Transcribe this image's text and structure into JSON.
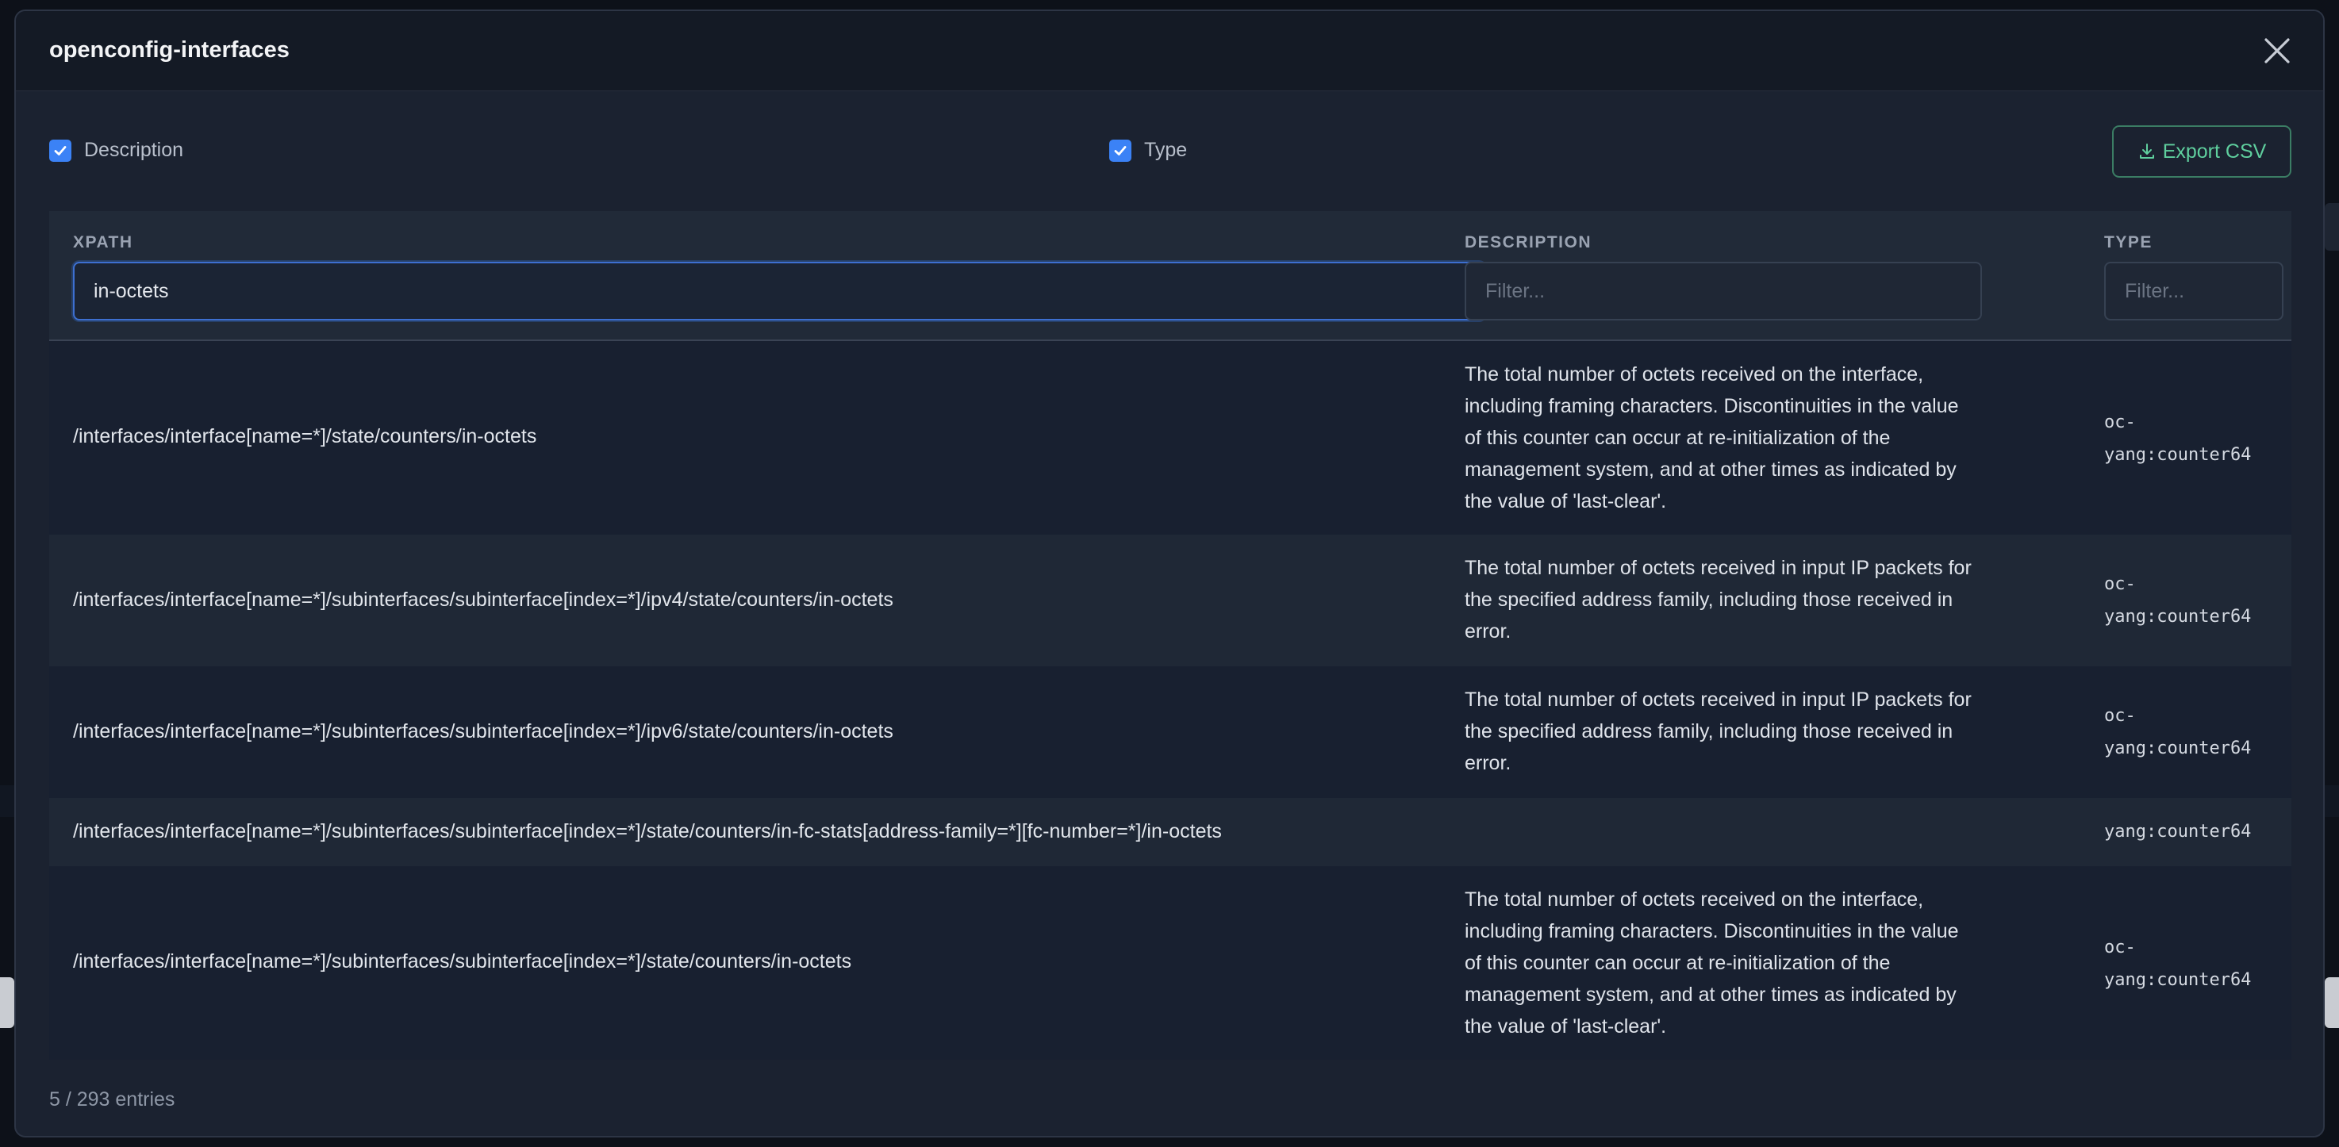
{
  "modal": {
    "title": "openconfig-interfaces",
    "close_icon": "close-icon"
  },
  "toolbar": {
    "description_toggle": {
      "label": "Description",
      "checked": true
    },
    "type_toggle": {
      "label": "Type",
      "checked": true
    },
    "export_label": "Export CSV",
    "export_icon": "download-icon"
  },
  "table": {
    "columns": {
      "xpath": "XPATH",
      "description": "DESCRIPTION",
      "type": "TYPE"
    },
    "filters": {
      "xpath_value": "in-octets",
      "description_placeholder": "Filter...",
      "type_placeholder": "Filter..."
    },
    "rows": [
      {
        "xpath": "/interfaces/interface[name=*]/state/counters/in-octets",
        "description": "The total number of octets received on the interface, including framing characters. Discontinuities in the value of this counter can occur at re-initialization of the management system, and at other times as indicated by the value of 'last-clear'.",
        "type": "oc-yang:counter64"
      },
      {
        "xpath": "/interfaces/interface[name=*]/subinterfaces/subinterface[index=*]/ipv4/state/counters/in-octets",
        "description": "The total number of octets received in input IP packets for the specified address family, including those received in error.",
        "type": "oc-yang:counter64"
      },
      {
        "xpath": "/interfaces/interface[name=*]/subinterfaces/subinterface[index=*]/ipv6/state/counters/in-octets",
        "description": "The total number of octets received in input IP packets for the specified address family, including those received in error.",
        "type": "oc-yang:counter64"
      },
      {
        "xpath": "/interfaces/interface[name=*]/subinterfaces/subinterface[index=*]/state/counters/in-fc-stats[address-family=*][fc-number=*]/in-octets",
        "description": "",
        "type": "yang:counter64"
      },
      {
        "xpath": "/interfaces/interface[name=*]/subinterfaces/subinterface[index=*]/state/counters/in-octets",
        "description": "The total number of octets received on the interface, including framing characters. Discontinuities in the value of this counter can occur at re-initialization of the management system, and at other times as indicated by the value of 'last-clear'.",
        "type": "oc-yang:counter64"
      }
    ]
  },
  "footer": {
    "entries": "5 / 293 entries"
  },
  "colors": {
    "accent": "#3b82f6",
    "export": "#5fcf9e",
    "background": "#1b2230"
  }
}
